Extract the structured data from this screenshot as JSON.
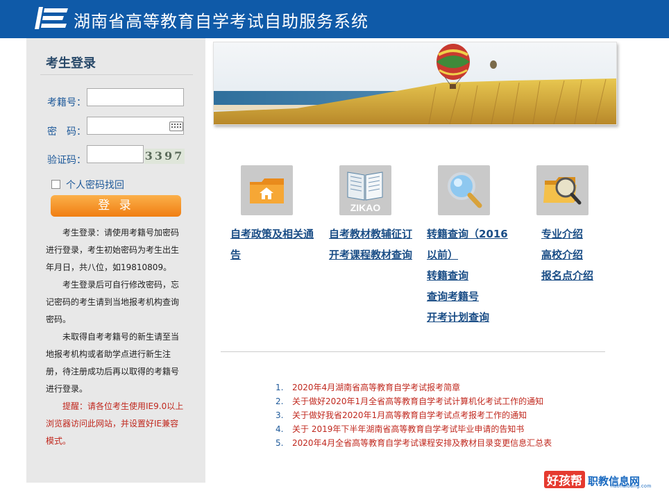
{
  "header": {
    "title": "湖南省高等教育自学考试自助服务系统"
  },
  "login": {
    "title": "考生登录",
    "exam_id_label": "考籍号：",
    "password_label": "密　码：",
    "captcha_label": "验证码：",
    "captcha_text": "3397",
    "recover_label": "个人密码找回",
    "login_button": "登 录",
    "notes": [
      "考生登录：请使用考籍号加密码进行登录，考生初始密码为考生出生年月日，共八位，如19810809。",
      "考生登录后可自行修改密码，忘记密码的考生请到当地报考机构查询密码。",
      "未取得自考考籍号的新生请至当地报考机构或者助学点进行新生注册，待注册成功后再以取得的考籍号进行登录。"
    ],
    "warning": "提醒：请各位考生使用IE9.0以上浏览器访问此网站，并设置好IE兼容模式。"
  },
  "tiles": {
    "zikao_text": "ZIKAO",
    "col1": [
      "自考政策及相关通告"
    ],
    "col2": [
      "自考教材教辅征订",
      "开考课程教材查询"
    ],
    "col3": [
      "转籍查询（2016以前）",
      "转籍查询",
      "查询考籍号",
      "开考计划查询"
    ],
    "col4": [
      "专业介绍",
      "高校介绍",
      "报名点介绍"
    ]
  },
  "news": [
    {
      "num": "1.",
      "text": "2020年4月湖南省高等教育自学考试报考简章"
    },
    {
      "num": "2.",
      "text": "关于做好2020年1月全省高等教育自学考试计算机化考试工作的通知"
    },
    {
      "num": "3.",
      "text": "关于做好我省2020年1月高等教育自学考试点考报考工作的通知"
    },
    {
      "num": "4.",
      "text": "关于 2019年下半年湖南省高等教育自学考试毕业申请的告知书"
    },
    {
      "num": "5.",
      "text": "2020年4月全省高等教育自学考试课程安排及教材目录变更信息汇总表"
    }
  ],
  "watermark": {
    "badge": "好孩帮",
    "text": "职教信息网",
    "sub": "haohaibang.com"
  },
  "colors": {
    "header_bg": "#0f5aa8",
    "login_button": "#f28a1e",
    "link": "#1a4d86",
    "news": "#c0281e"
  }
}
